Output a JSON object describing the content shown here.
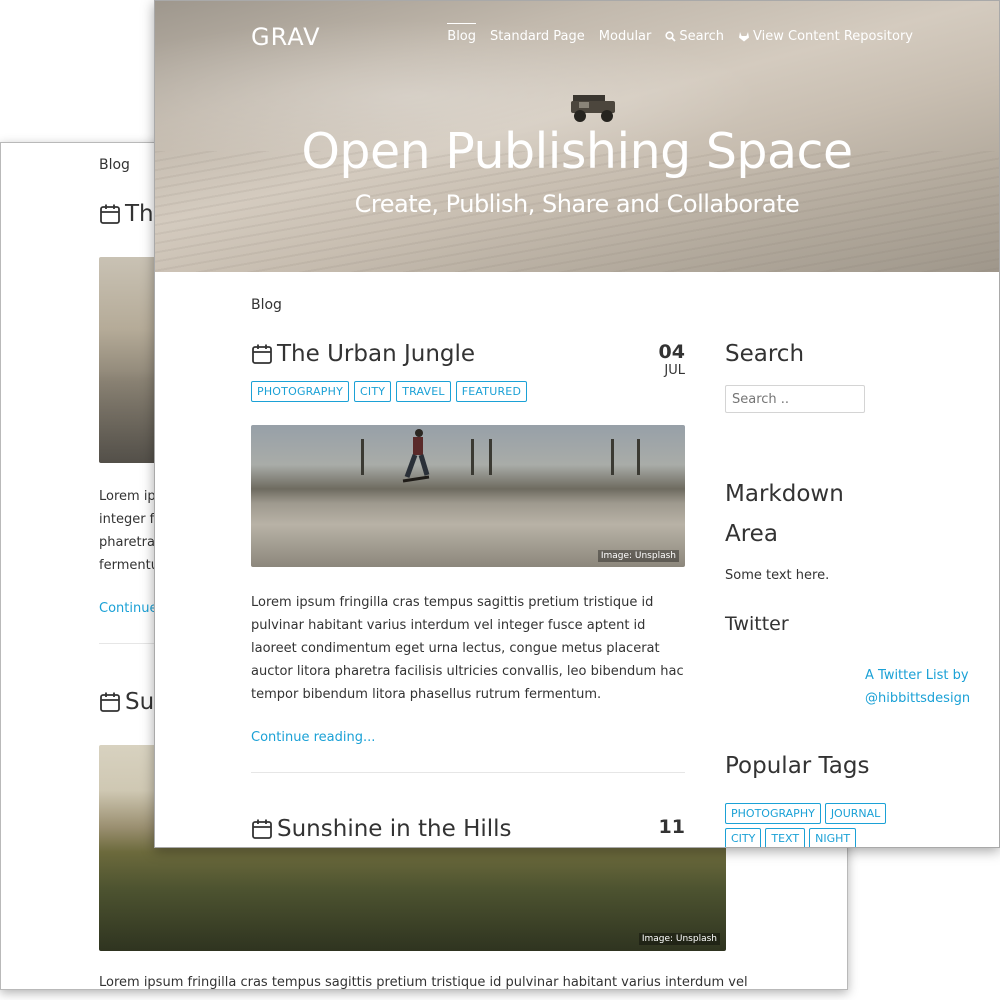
{
  "back_window": {
    "breadcrumb": "Blog",
    "post1_title_fragment": "Th",
    "excerpt_lines": [
      "Lorem ip",
      "integer fu",
      "pharetra",
      "fermentu"
    ],
    "continue_fragment": "Continue",
    "post2_title_fragment": "Su",
    "image_caption": "Image: Unsplash",
    "bottom_text": "Lorem ipsum fringilla cras tempus sagittis pretium tristique id pulvinar habitant varius interdum vel"
  },
  "site": {
    "logo": "GRAV",
    "nav": [
      {
        "label": "Blog",
        "icon": ""
      },
      {
        "label": "Standard Page",
        "icon": ""
      },
      {
        "label": "Modular",
        "icon": ""
      },
      {
        "label": "Search",
        "icon": "search-icon"
      },
      {
        "label": "View Content Repository",
        "icon": "gitlab-icon"
      }
    ],
    "hero_title": "Open Publishing Space",
    "hero_subtitle": "Create, Publish, Share and Collaborate",
    "breadcrumb": "Blog"
  },
  "post1": {
    "title": "The Urban Jungle",
    "day": "04",
    "month": "JUL",
    "tags": [
      "PHOTOGRAPHY",
      "CITY",
      "TRAVEL",
      "FEATURED"
    ],
    "image_caption": "Image: Unsplash",
    "excerpt": "Lorem ipsum fringilla cras tempus sagittis pretium tristique id pulvinar habitant varius interdum vel integer fusce aptent id laoreet condimentum eget urna lectus, congue metus placerat auctor litora pharetra facilisis ultricies convallis, leo bibendum hac tempor bibendum litora phasellus rutrum fermentum.",
    "continue_label": "Continue reading..."
  },
  "post2": {
    "title": "Sunshine in the Hills",
    "day": "11"
  },
  "sidebar": {
    "search_heading": "Search",
    "search_placeholder": "Search ..",
    "markdown_heading": "Markdown Area",
    "markdown_text": "Some text here.",
    "twitter_heading": "Twitter",
    "twitter_link": "A Twitter List by @hibbittsdesign",
    "tags_heading": "Popular Tags",
    "tags": [
      "PHOTOGRAPHY",
      "JOURNAL",
      "CITY",
      "TEXT",
      "NIGHT"
    ]
  },
  "colors": {
    "accent": "#1ba1d6",
    "text": "#333333"
  }
}
